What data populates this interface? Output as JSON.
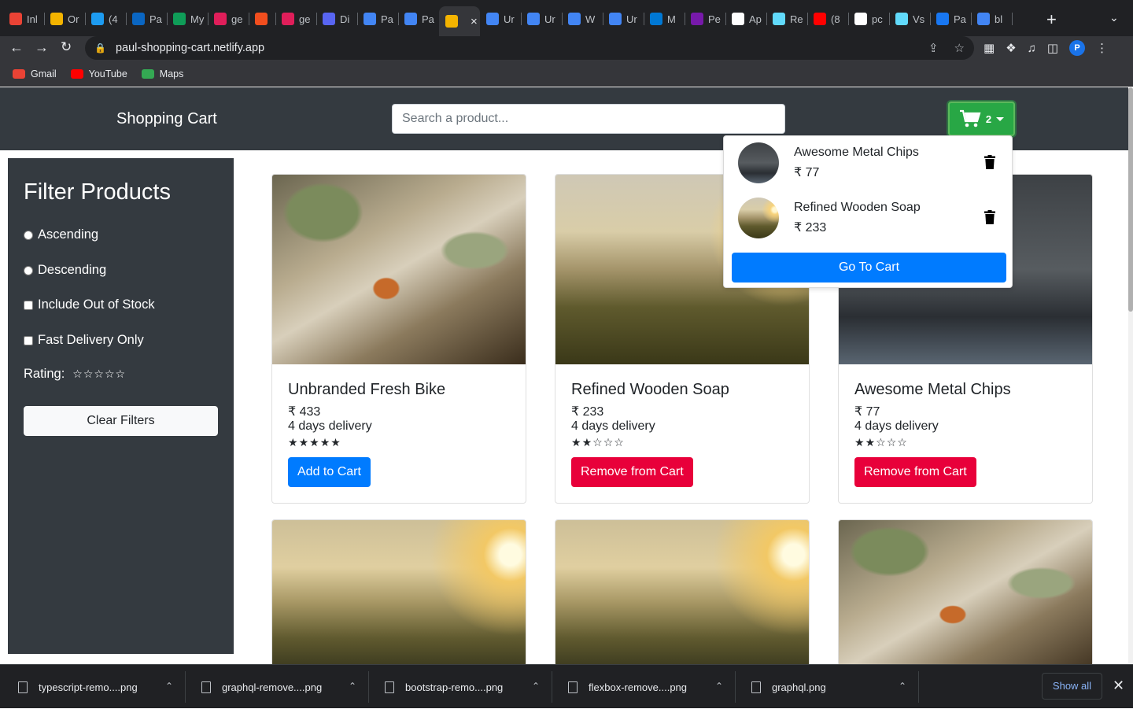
{
  "browser": {
    "tabs": [
      {
        "label": "Inl",
        "icon": "gmail-icon",
        "color": "#ea4335"
      },
      {
        "label": "Or",
        "icon": "tools-icon",
        "color": "#f4b400"
      },
      {
        "label": "(4",
        "icon": "twitter-icon",
        "color": "#1d9bf0"
      },
      {
        "label": "Pa",
        "icon": "linkedin-icon",
        "color": "#0a66c2"
      },
      {
        "label": "My",
        "icon": "app-icon",
        "color": "#0f9d58"
      },
      {
        "label": "ge",
        "icon": "slack-icon",
        "color": "#e01e5a"
      },
      {
        "label": "",
        "icon": "figma-icon",
        "color": "#f24e1e"
      },
      {
        "label": "ge",
        "icon": "slack-icon",
        "color": "#e01e5a"
      },
      {
        "label": "Di",
        "icon": "discord-icon",
        "color": "#5865f2"
      },
      {
        "label": "Pa",
        "icon": "docs-icon",
        "color": "#4285f4"
      },
      {
        "label": "Pa",
        "icon": "docs-icon",
        "color": "#4285f4"
      },
      {
        "label": "",
        "icon": "cart-favicon",
        "color": "#f4b400",
        "active": true
      },
      {
        "label": "Ur",
        "icon": "docs-icon",
        "color": "#4285f4"
      },
      {
        "label": "Ur",
        "icon": "docs-icon",
        "color": "#4285f4"
      },
      {
        "label": "W",
        "icon": "docs-icon",
        "color": "#4285f4"
      },
      {
        "label": "Ur",
        "icon": "docs-icon",
        "color": "#4285f4"
      },
      {
        "label": "M",
        "icon": "azure-icon",
        "color": "#0078d4"
      },
      {
        "label": "Pe",
        "icon": "onenote-icon",
        "color": "#7719aa"
      },
      {
        "label": "Ap",
        "icon": "notion-icon",
        "color": "#ffffff"
      },
      {
        "label": "Re",
        "icon": "react-icon",
        "color": "#61dafb"
      },
      {
        "label": "(8",
        "icon": "youtube-icon",
        "color": "#ff0000"
      },
      {
        "label": "pc",
        "icon": "github-icon",
        "color": "#ffffff"
      },
      {
        "label": "Vs",
        "icon": "react-icon",
        "color": "#61dafb"
      },
      {
        "label": "Pa",
        "icon": "facebook-icon",
        "color": "#1877f2"
      },
      {
        "label": "bl",
        "icon": "google-icon",
        "color": "#4285f4"
      }
    ],
    "url": "paul-shopping-cart.netlify.app",
    "profile_initial": "P",
    "bookmarks": [
      {
        "label": "Gmail",
        "color": "#ea4335"
      },
      {
        "label": "YouTube",
        "color": "#ff0000"
      },
      {
        "label": "Maps",
        "color": "#34a853"
      }
    ]
  },
  "header": {
    "brand": "Shopping Cart",
    "search_placeholder": "Search a product...",
    "cart_count": "2"
  },
  "filters": {
    "title": "Filter Products",
    "ascending": "Ascending",
    "descending": "Descending",
    "out_of_stock": "Include Out of Stock",
    "fast_delivery": "Fast Delivery Only",
    "rating_label": "Rating:",
    "rating_value": 0,
    "clear": "Clear Filters"
  },
  "cart_dropdown": {
    "items": [
      {
        "name": "Awesome Metal Chips",
        "price": "₹ 77"
      },
      {
        "name": "Refined Wooden Soap",
        "price": "₹ 233"
      }
    ],
    "go_to_cart": "Go To Cart"
  },
  "products": [
    {
      "name": "Unbranded Fresh Bike",
      "price": "₹ 433",
      "delivery": "4 days delivery",
      "rating": 5,
      "button": "Add to Cart",
      "in_cart": false
    },
    {
      "name": "Refined Wooden Soap",
      "price": "₹ 233",
      "delivery": "4 days delivery",
      "rating": 2,
      "button": "Remove from Cart",
      "in_cart": true
    },
    {
      "name": "Awesome Metal Chips",
      "price": "₹ 77",
      "delivery": "4 days delivery",
      "rating": 2,
      "button": "Remove from Cart",
      "in_cart": true
    }
  ],
  "downloads": {
    "files": [
      "typescript-remo....png",
      "graphql-remove....png",
      "bootstrap-remo....png",
      "flexbox-remove....png",
      "graphql.png"
    ],
    "show_all": "Show all"
  }
}
